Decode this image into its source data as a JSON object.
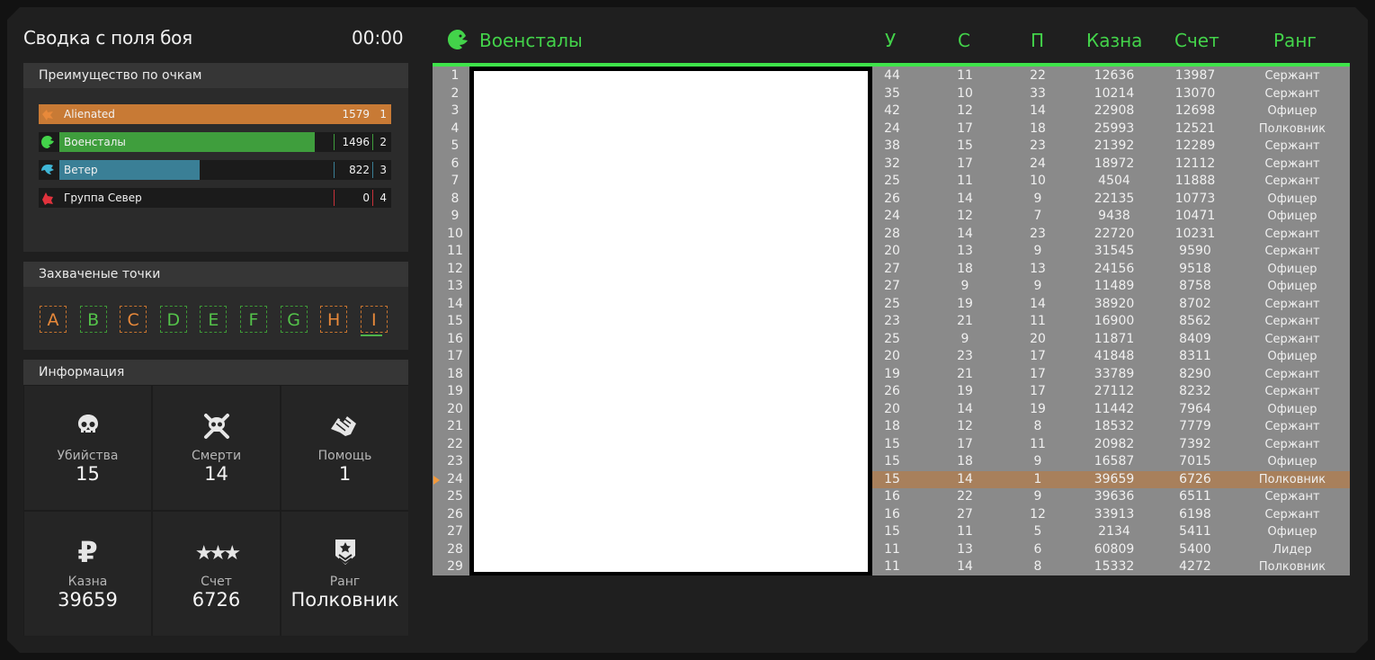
{
  "summary": {
    "title": "Сводка с поля боя",
    "timer": "00:00"
  },
  "points_panel": {
    "header": "Преимущество по очкам",
    "teams": [
      {
        "name": "Alienated",
        "score": "1579",
        "rank": "1",
        "color": "#c87a35",
        "fill": 1.0,
        "icon": "fox-icon"
      },
      {
        "name": "Военсталы",
        "score": "1496",
        "rank": "2",
        "color": "#3f9e3d",
        "fill": 0.947,
        "icon": "eagle-icon"
      },
      {
        "name": "Ветер",
        "score": "822",
        "rank": "3",
        "color": "#3a7f96",
        "fill": 0.52,
        "icon": "bird-icon"
      },
      {
        "name": "Группа Север",
        "score": "0",
        "rank": "4",
        "color": "#c8323a",
        "fill": 0,
        "icon": "wolf-icon"
      }
    ]
  },
  "captured": {
    "header": "Захваченые точки",
    "points": [
      {
        "letter": "A",
        "owner": "o"
      },
      {
        "letter": "B",
        "owner": "g"
      },
      {
        "letter": "C",
        "owner": "o"
      },
      {
        "letter": "D",
        "owner": "g"
      },
      {
        "letter": "E",
        "owner": "g"
      },
      {
        "letter": "F",
        "owner": "g"
      },
      {
        "letter": "G",
        "owner": "g"
      },
      {
        "letter": "H",
        "owner": "o"
      },
      {
        "letter": "I",
        "owner": "o"
      }
    ]
  },
  "info": {
    "header": "Информация",
    "kills_label": "Убийства",
    "kills": "15",
    "deaths_label": "Смерти",
    "deaths": "14",
    "assists_label": "Помощь",
    "assists": "1",
    "money_label": "Казна",
    "money": "39659",
    "score_label": "Счет",
    "score": "6726",
    "rank_label": "Ранг",
    "rank": "Полковник"
  },
  "table": {
    "team_name": "Военсталы",
    "col_k": "У",
    "col_d": "С",
    "col_a": "П",
    "col_money": "Казна",
    "col_score": "Счет",
    "col_rank": "Ранг",
    "highlight_row": 23,
    "rows": [
      [
        "1",
        "44",
        "11",
        "22",
        "12636",
        "13987",
        "Сержант"
      ],
      [
        "2",
        "35",
        "10",
        "33",
        "10214",
        "13070",
        "Сержант"
      ],
      [
        "3",
        "42",
        "12",
        "14",
        "22908",
        "12698",
        "Офицер"
      ],
      [
        "4",
        "24",
        "17",
        "18",
        "25993",
        "12521",
        "Полковник"
      ],
      [
        "5",
        "38",
        "15",
        "23",
        "21392",
        "12289",
        "Сержант"
      ],
      [
        "6",
        "32",
        "17",
        "24",
        "18972",
        "12112",
        "Сержант"
      ],
      [
        "7",
        "25",
        "11",
        "10",
        "4504",
        "11888",
        "Сержант"
      ],
      [
        "8",
        "26",
        "14",
        "9",
        "22135",
        "10773",
        "Офицер"
      ],
      [
        "9",
        "24",
        "12",
        "7",
        "9438",
        "10471",
        "Офицер"
      ],
      [
        "10",
        "28",
        "14",
        "23",
        "22720",
        "10231",
        "Сержант"
      ],
      [
        "11",
        "20",
        "13",
        "9",
        "31545",
        "9590",
        "Сержант"
      ],
      [
        "12",
        "27",
        "18",
        "13",
        "24156",
        "9518",
        "Офицер"
      ],
      [
        "13",
        "27",
        "9",
        "9",
        "11489",
        "8758",
        "Офицер"
      ],
      [
        "14",
        "25",
        "19",
        "14",
        "38920",
        "8702",
        "Сержант"
      ],
      [
        "15",
        "23",
        "21",
        "11",
        "16900",
        "8562",
        "Сержант"
      ],
      [
        "16",
        "25",
        "9",
        "20",
        "11871",
        "8409",
        "Сержант"
      ],
      [
        "17",
        "20",
        "23",
        "17",
        "41848",
        "8311",
        "Офицер"
      ],
      [
        "18",
        "19",
        "21",
        "17",
        "33789",
        "8290",
        "Сержант"
      ],
      [
        "19",
        "26",
        "19",
        "17",
        "27112",
        "8232",
        "Сержант"
      ],
      [
        "20",
        "20",
        "14",
        "19",
        "11442",
        "7964",
        "Офицер"
      ],
      [
        "21",
        "18",
        "12",
        "8",
        "18532",
        "7779",
        "Сержант"
      ],
      [
        "22",
        "15",
        "17",
        "11",
        "20982",
        "7392",
        "Сержант"
      ],
      [
        "23",
        "15",
        "18",
        "9",
        "16587",
        "7015",
        "Офицер"
      ],
      [
        "24",
        "15",
        "14",
        "1",
        "39659",
        "6726",
        "Полковник"
      ],
      [
        "25",
        "16",
        "22",
        "9",
        "39636",
        "6511",
        "Сержант"
      ],
      [
        "26",
        "16",
        "27",
        "12",
        "33913",
        "6198",
        "Сержант"
      ],
      [
        "27",
        "15",
        "11",
        "5",
        "2134",
        "5411",
        "Офицер"
      ],
      [
        "28",
        "11",
        "13",
        "6",
        "60809",
        "5400",
        "Лидер"
      ],
      [
        "29",
        "11",
        "14",
        "8",
        "15332",
        "4272",
        "Полковник"
      ]
    ]
  }
}
